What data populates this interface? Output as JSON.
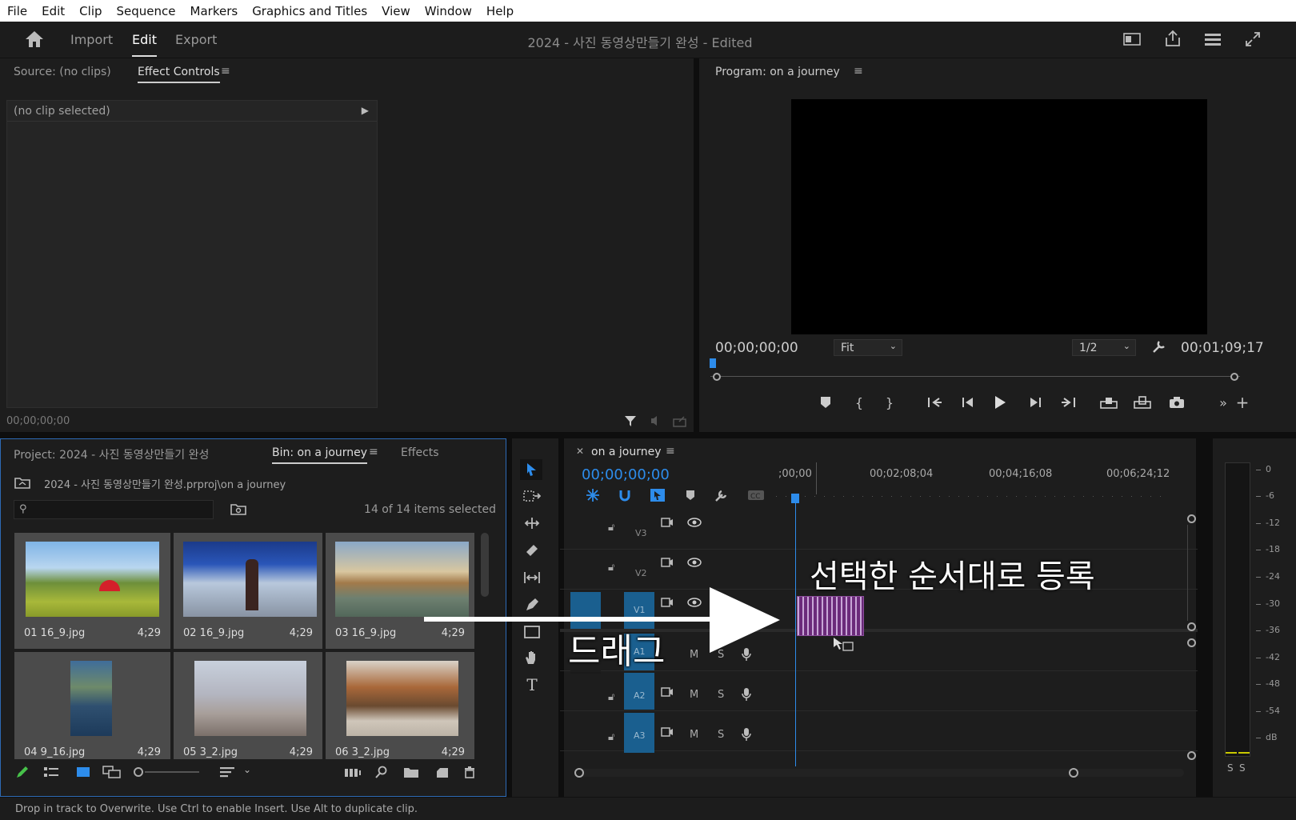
{
  "menu": [
    "File",
    "Edit",
    "Clip",
    "Sequence",
    "Markers",
    "Graphics and Titles",
    "View",
    "Window",
    "Help"
  ],
  "header": {
    "nav": [
      "Import",
      "Edit",
      "Export"
    ],
    "title": "2024 - 사진 동영상만들기 완성",
    "edited": " - Edited"
  },
  "source_panel": {
    "tab_source": "Source: (no clips)",
    "tab_effect": "Effect Controls",
    "no_clip": "(no clip selected)",
    "timecode": "00;00;00;00"
  },
  "program": {
    "tab": "Program: on a journey",
    "timecode_left": "00;00;00;00",
    "fit": "Fit",
    "resolution": "1/2",
    "timecode_right": "00;01;09;17"
  },
  "project": {
    "tab_project": "Project: 2024 - 사진 동영상만들기 완성",
    "tab_bin": "Bin: on a journey",
    "tab_effects": "Effects",
    "path": "2024 - 사진 동영상만들기 완성.prproj\\on a journey",
    "search_placeholder": "",
    "count": "14 of 14 items selected",
    "items": [
      {
        "name": "01 16_9.jpg",
        "dur": "4;29"
      },
      {
        "name": "02 16_9.jpg",
        "dur": "4;29"
      },
      {
        "name": "03 16_9.jpg",
        "dur": "4;29"
      },
      {
        "name": "04 9_16.jpg",
        "dur": "4;29"
      },
      {
        "name": "05 3_2.jpg",
        "dur": "4;29"
      },
      {
        "name": "06 3_2.jpg",
        "dur": "4;29"
      }
    ]
  },
  "timeline": {
    "tab": "on a journey",
    "timecode": "00;00;00;00",
    "ruler": [
      ";00;00",
      "00;02;08;04",
      "00;04;16;08",
      "00;06;24;12"
    ],
    "tracks": [
      "V3",
      "V2",
      "V1",
      "A1",
      "A2",
      "A3"
    ],
    "track_buttons": {
      "m": "M",
      "s": "S"
    }
  },
  "meter": {
    "scale": [
      "0",
      "-6",
      "-12",
      "-18",
      "-24",
      "-30",
      "-36",
      "-42",
      "-48",
      "-54",
      "dB"
    ],
    "solo": [
      "S",
      "S"
    ]
  },
  "annotations": {
    "register": "선택한 순서대로 등록",
    "drag": "드래그"
  },
  "status": "Drop in track to Overwrite. Use Ctrl to enable Insert. Use Alt to duplicate clip.",
  "colors": {
    "accent": "#2d8ceb",
    "clip": "#6b2a7a",
    "track_target": "#1a5f8f"
  }
}
